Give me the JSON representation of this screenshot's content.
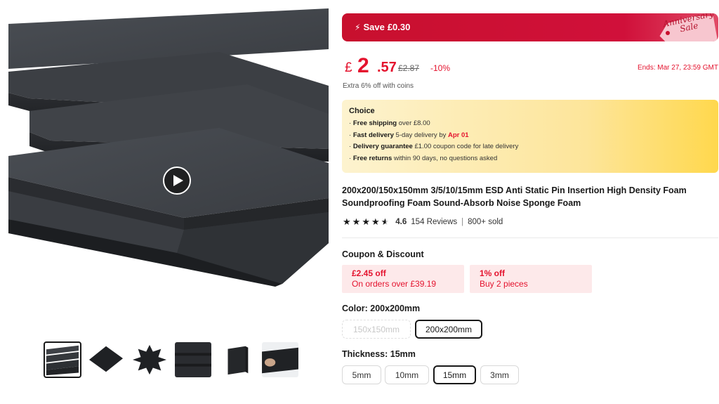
{
  "gallery": {
    "main_image": "black-esd-foam-sheets-stacked",
    "play_icon": "play-icon",
    "thumbnails": [
      {
        "name": "thumb-foam-stack"
      },
      {
        "name": "thumb-foam-square-tilted"
      },
      {
        "name": "thumb-foam-star"
      },
      {
        "name": "thumb-foam-blocks"
      },
      {
        "name": "thumb-foam-pad"
      },
      {
        "name": "thumb-foam-hand"
      }
    ]
  },
  "banner": {
    "save_label": "Save",
    "save_amount": "£0.30",
    "tag_text": "Anniversary Sale",
    "bolt_icon": "⚡"
  },
  "price": {
    "currency": "£",
    "integer": "2",
    "decimal": ".57",
    "original": "£2.87",
    "discount": "-10%",
    "ends": "Ends: Mar 27, 23:59 GMT"
  },
  "coins_text": "Extra 6% off with coins",
  "choice": {
    "title": "Choice",
    "lines": [
      {
        "bold": "Free shipping",
        "text": " over £8.00",
        "red": ""
      },
      {
        "bold": "Fast delivery",
        "text": " 5-day delivery by ",
        "red": "Apr 01"
      },
      {
        "bold": "Delivery guarantee",
        "text": "  £1.00 coupon code for late delivery",
        "red": ""
      },
      {
        "bold": "Free returns",
        "text": "  within 90 days, no questions asked",
        "red": ""
      }
    ]
  },
  "product_title": "200x200/150x150mm 3/5/10/15mm ESD Anti Static Pin Insertion High Density Foam Soundproofing Foam Sound-Absorb Noise Sponge Foam",
  "rating": {
    "stars": 4.6,
    "score": "4.6",
    "reviews": "154 Reviews",
    "sold": "800+ sold"
  },
  "coupons": {
    "label": "Coupon & Discount",
    "items": [
      {
        "line1": "£2.45 off",
        "line2": "On orders over £39.19"
      },
      {
        "line1": "1% off",
        "line2": "Buy 2 pieces"
      }
    ]
  },
  "color": {
    "label": "Color: 200x200mm",
    "options": [
      {
        "text": "150x150mm",
        "state": "disabled"
      },
      {
        "text": "200x200mm",
        "state": "selected"
      }
    ]
  },
  "thickness": {
    "label": "Thickness: 15mm",
    "options": [
      {
        "text": "5mm",
        "state": "normal"
      },
      {
        "text": "10mm",
        "state": "normal"
      },
      {
        "text": "15mm",
        "state": "selected"
      },
      {
        "text": "3mm",
        "state": "normal"
      }
    ]
  },
  "colors": {
    "accent_red": "#e4132e",
    "banner_red": "#c8102e",
    "choice_yellow": "#ffd84d"
  }
}
